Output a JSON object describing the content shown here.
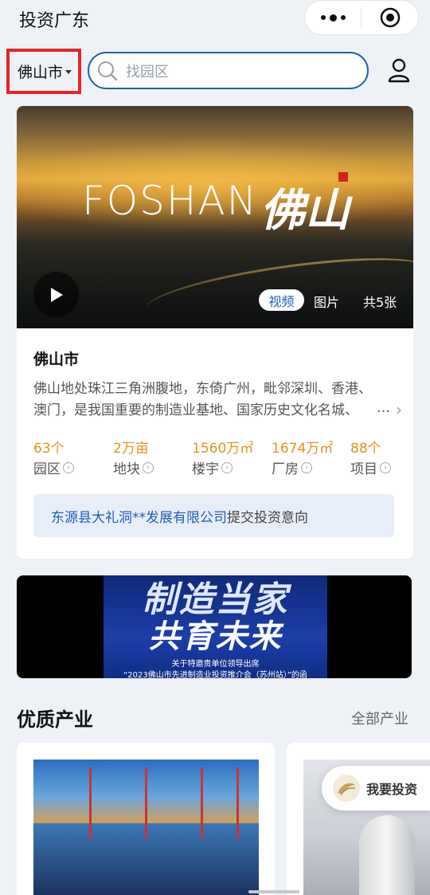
{
  "app_title": "投资广东",
  "city_selector": {
    "label": "佛山市"
  },
  "search": {
    "placeholder": "找园区"
  },
  "hero": {
    "word": "FOSHAN",
    "cn_calligraphy": "佛山",
    "tabs": {
      "video": "视频",
      "photo": "图片"
    },
    "count": "共5张"
  },
  "city_card": {
    "title": "佛山市",
    "description": "佛山地处珠江三角洲腹地，东倚广州，毗邻深圳、香港、澳门，是我国重要的制造业基地、国家历史文化名城、",
    "more": "…",
    "stats": [
      {
        "value": "63个",
        "label": "园区"
      },
      {
        "value": "2万亩",
        "label": "地块"
      },
      {
        "value": "1560万㎡",
        "label": "楼宇"
      },
      {
        "value": "1674万㎡",
        "label": "厂房"
      },
      {
        "value": "88个",
        "label": "项目"
      }
    ],
    "intent": {
      "company": "东源县大礼洞**发展有限公司",
      "text": "提交投资意向"
    }
  },
  "banner": {
    "line1": "制造当家",
    "line2": "共育未来",
    "sub1": "关于特邀贵单位领导出席",
    "sub2": "“2023佛山市先进制造业投资推介会（苏州站）”的函"
  },
  "industry_section": {
    "title": "优质产业",
    "link": "全部产业"
  },
  "float_button": {
    "label": "我要投资"
  },
  "colors": {
    "accent": "#1f5fb5",
    "stat": "#e8901f",
    "highlight": "#e5252a"
  }
}
